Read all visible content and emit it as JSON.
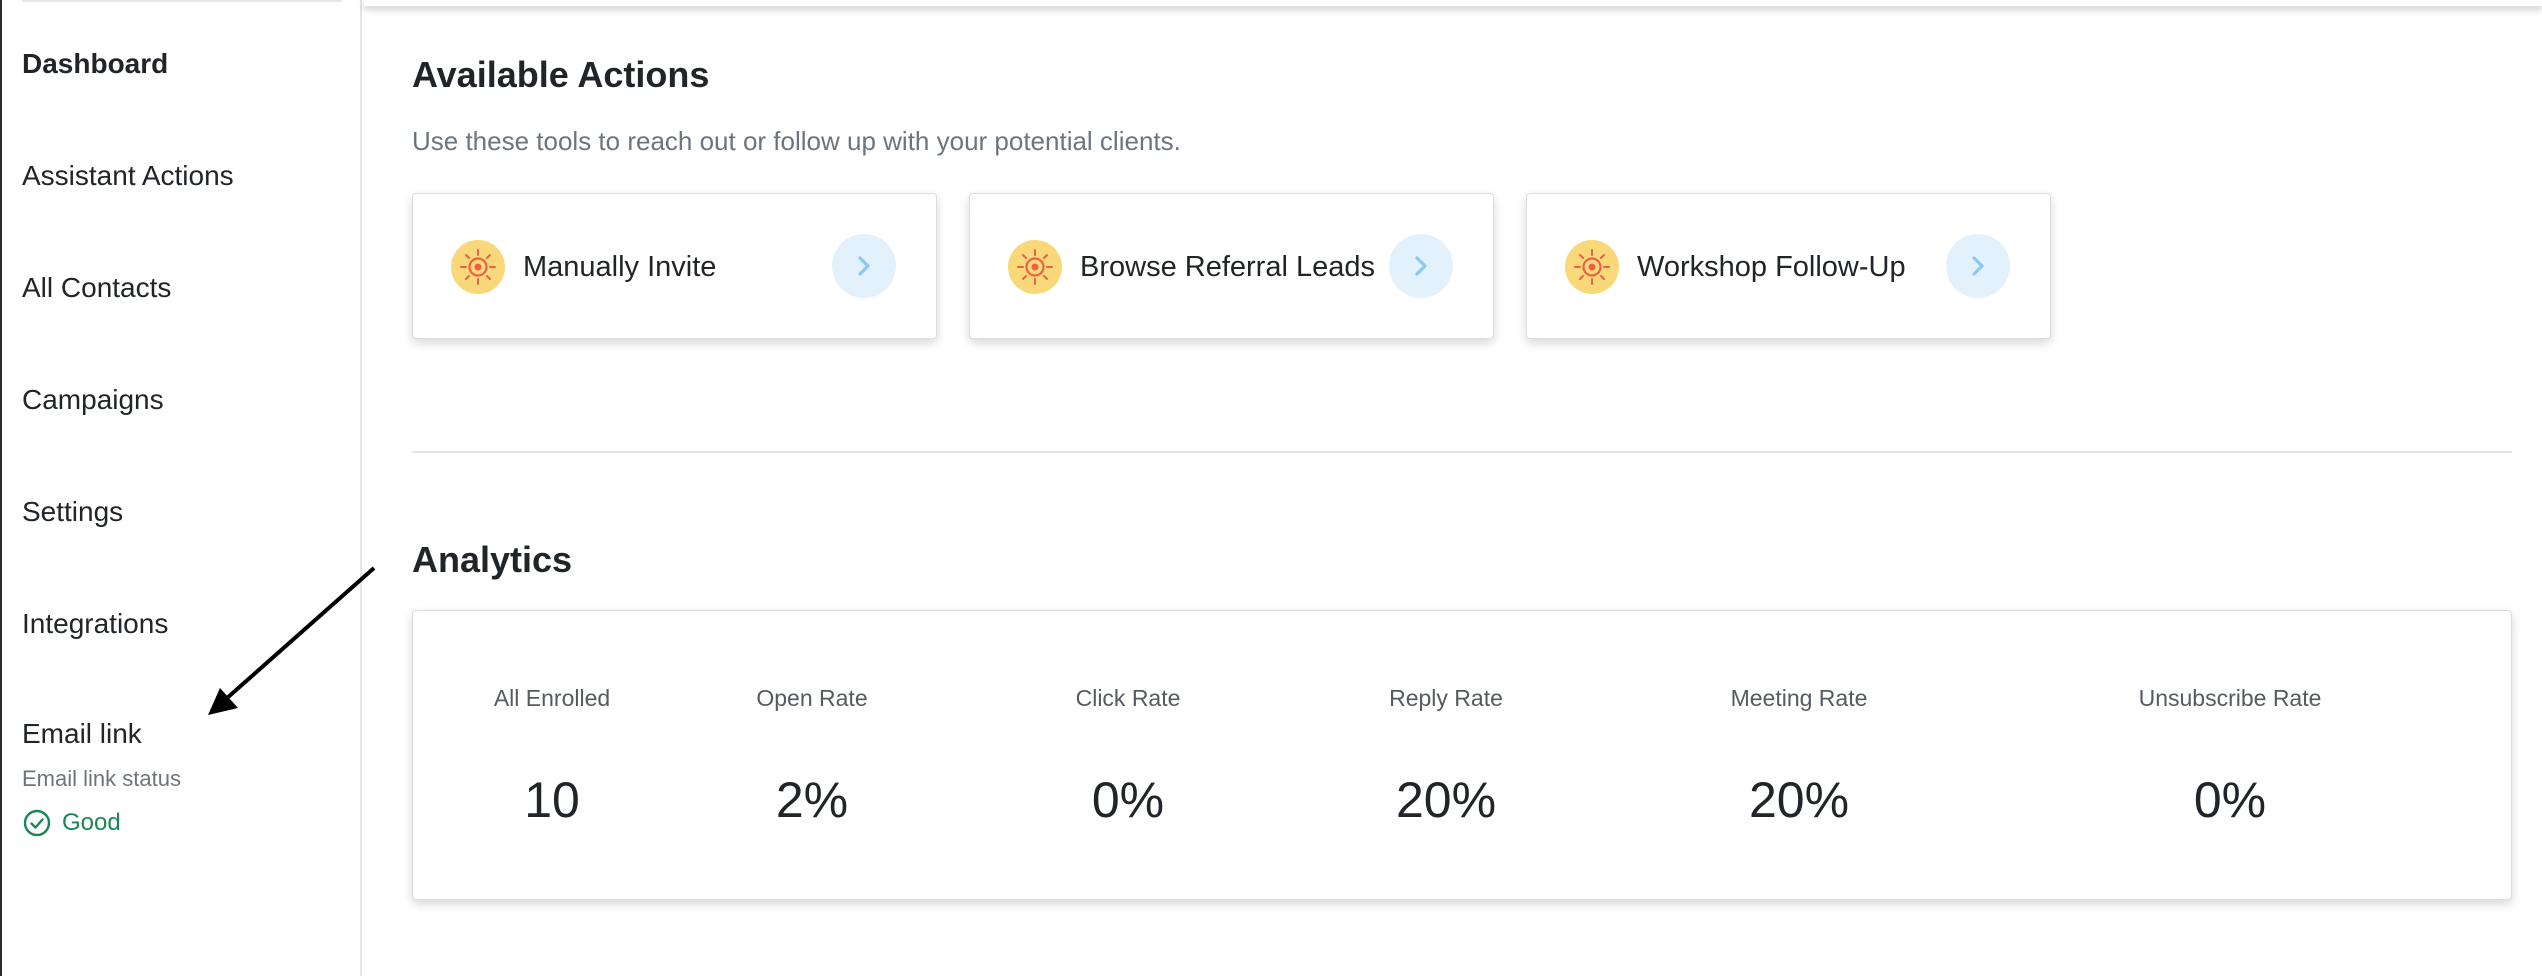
{
  "sidebar": {
    "items": [
      {
        "label": "Dashboard",
        "active": true
      },
      {
        "label": "Assistant Actions",
        "active": false
      },
      {
        "label": "All Contacts",
        "active": false
      },
      {
        "label": "Campaigns",
        "active": false
      },
      {
        "label": "Settings",
        "active": false
      },
      {
        "label": "Integrations",
        "active": false
      }
    ],
    "email_link": {
      "title": "Email link",
      "subtitle": "Email link status",
      "status": "Good",
      "status_color": "#198754"
    }
  },
  "actions": {
    "title": "Available Actions",
    "subtitle": "Use these tools to reach out or follow up with your potential clients.",
    "cards": [
      {
        "label": "Manually Invite",
        "icon": "target-icon"
      },
      {
        "label": "Browse Referral Leads",
        "icon": "target-icon"
      },
      {
        "label": "Workshop Follow-Up",
        "icon": "target-icon"
      }
    ]
  },
  "analytics": {
    "title": "Analytics",
    "metrics": [
      {
        "label": "All Enrolled",
        "value": "10"
      },
      {
        "label": "Open Rate",
        "value": "2%"
      },
      {
        "label": "Click Rate",
        "value": "0%"
      },
      {
        "label": "Reply Rate",
        "value": "20%"
      },
      {
        "label": "Meeting Rate",
        "value": "20%"
      },
      {
        "label": "Unsubscribe Rate",
        "value": "0%"
      }
    ]
  },
  "colors": {
    "badge": "#f9d87a",
    "chevron_bg": "#e3f1fc",
    "chevron": "#8cc8f2"
  }
}
